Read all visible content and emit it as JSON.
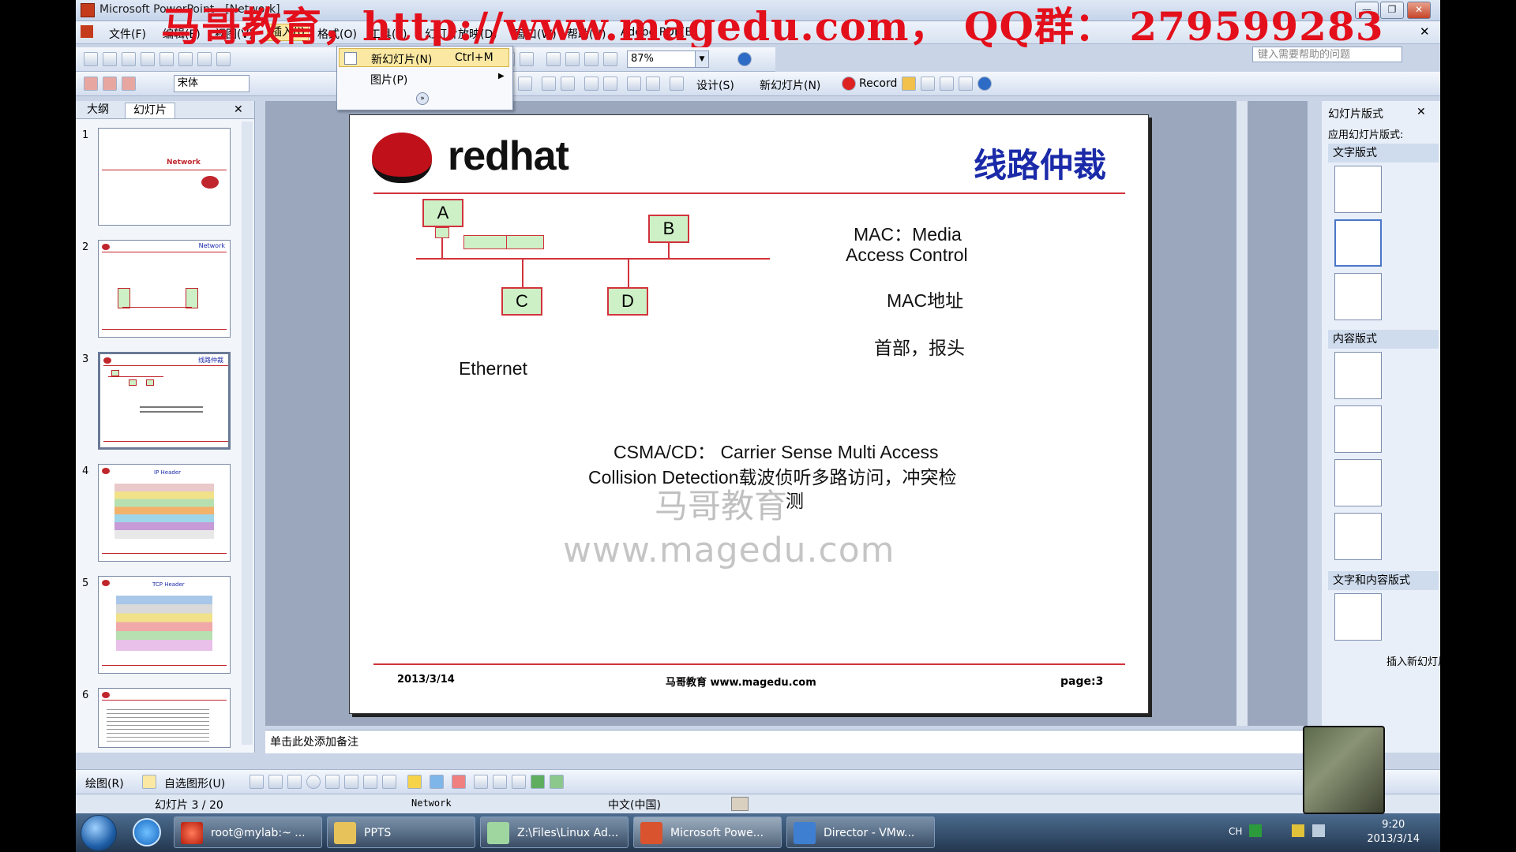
{
  "window": {
    "title": "Microsoft PowerPoint - [Network]",
    "minimize": "—",
    "restore": "❐",
    "close": "✕"
  },
  "banner": "马哥教育，http://www.magedu.com， QQ群： 279599283",
  "menu": [
    "文件(F)",
    "编辑(E)",
    "视图(V)",
    "插入(I)",
    "格式(O)",
    "工具(T)",
    "幻灯片放映(D)",
    "窗口(W)",
    "帮助(H)",
    "Adobe PDF(B)"
  ],
  "ask_placeholder": "键入需要帮助的问题",
  "toolbar": {
    "zoom": "87%",
    "font": "宋体",
    "design": "设计(S)",
    "new_slide": "新幻灯片(N)",
    "record": "Record"
  },
  "dropdown": {
    "items": [
      {
        "label": "新幻灯片(N)",
        "shortcut": "Ctrl+M"
      },
      {
        "label": "图片(P)",
        "shortcut": ""
      }
    ]
  },
  "left_panel": {
    "tabs": [
      "大纲",
      "幻灯片"
    ],
    "thumbs": [
      {
        "num": "1",
        "label": "Network"
      },
      {
        "num": "2",
        "label": "Network"
      },
      {
        "num": "3",
        "label": "线路仲裁"
      },
      {
        "num": "4",
        "label": "IP Header"
      },
      {
        "num": "5",
        "label": "TCP Header"
      },
      {
        "num": "6",
        "label": ""
      }
    ]
  },
  "slide": {
    "logo_text": "redhat",
    "title": "线路仲裁",
    "nodes": [
      "A",
      "B",
      "C",
      "D"
    ],
    "mac_line1": "MAC：Media",
    "mac_line2": "Access Control",
    "mac_addr": "MAC地址",
    "header": "首部，报头",
    "ethernet": "Ethernet",
    "csma_line1": "CSMA/CD： Carrier Sense Multi Access",
    "csma_line2": "Collision  Detection载波侦听多路访问，冲突检",
    "csma_line3": "测",
    "watermark1": "马哥教育",
    "watermark2": "www.magedu.com",
    "footer_date": "2013/3/14",
    "footer_center": "马哥教育 www.magedu.com",
    "footer_page": "page:3"
  },
  "notes_placeholder": "单击此处添加备注",
  "task_pane": {
    "title": "幻灯片版式",
    "apply_label": "应用幻灯片版式:",
    "section_text": "文字版式",
    "section_content": "内容版式",
    "section_text_content": "文字和内容版式",
    "show_when_insert": "插入新幻灯片时放映"
  },
  "drawbar": {
    "draw": "绘图(R)",
    "autoshape": "自选图形(U)"
  },
  "status": {
    "slide_pos": "幻灯片 3 / 20",
    "design": "Network",
    "language": "中文(中国)"
  },
  "taskbar": {
    "tasks": [
      {
        "label": "root@mylab:~ ..."
      },
      {
        "label": "PPTS"
      },
      {
        "label": "Z:\\Files\\Linux Ad..."
      },
      {
        "label": "Microsoft Powe..."
      },
      {
        "label": "Director - VMw..."
      }
    ],
    "lang": "CH",
    "time": "9:20",
    "date": "2013/3/14"
  },
  "colors": {
    "accent_red": "#d2333c",
    "node_fill": "#cdf0c6",
    "title_blue": "#1a2aa8"
  }
}
